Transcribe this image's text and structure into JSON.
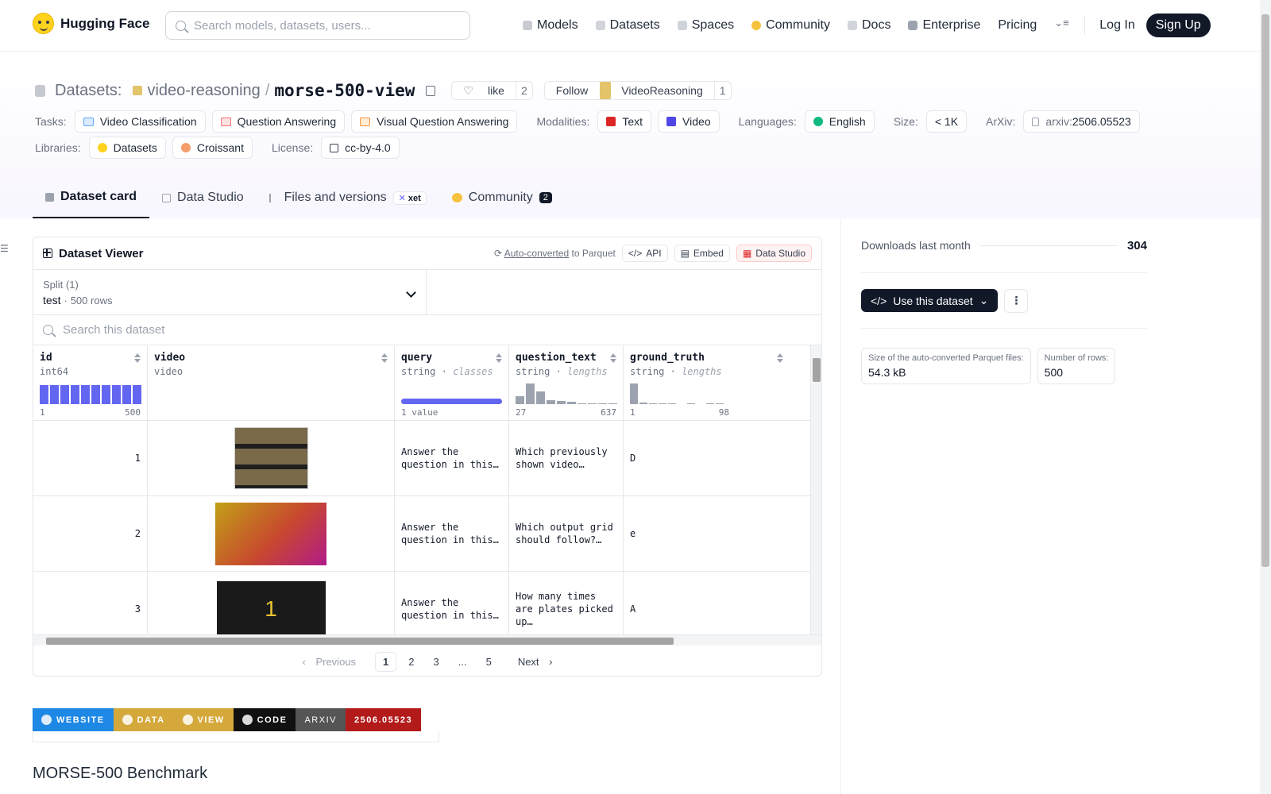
{
  "nav": {
    "brand": "Hugging Face",
    "search_placeholder": "Search models, datasets, users...",
    "links": [
      "Models",
      "Datasets",
      "Spaces",
      "Community",
      "Docs",
      "Enterprise",
      "Pricing"
    ],
    "login": "Log In",
    "signup": "Sign Up"
  },
  "header": {
    "crumb_label": "Datasets:",
    "org": "video-reasoning",
    "name": "morse-500-view",
    "like_label": "like",
    "like_count": "2",
    "follow_label": "Follow",
    "follow_org": "VideoReasoning",
    "follow_count": "1"
  },
  "tags": {
    "tasks_label": "Tasks:",
    "tasks": [
      "Video Classification",
      "Question Answering",
      "Visual Question Answering"
    ],
    "modalities_label": "Modalities:",
    "modalities": [
      "Text",
      "Video"
    ],
    "languages_label": "Languages:",
    "language": "English",
    "size_label": "Size:",
    "size": "< 1K",
    "arxiv_label": "ArXiv:",
    "arxiv_prefix": "arxiv:",
    "arxiv_id": "2506.05523",
    "libraries_label": "Libraries:",
    "libraries": [
      "Datasets",
      "Croissant"
    ],
    "license_label": "License:",
    "license": "cc-by-4.0"
  },
  "tabs": [
    "Dataset card",
    "Data Studio",
    "Files and versions",
    "Community"
  ],
  "tabs_extra": {
    "xet": "xet",
    "community_count": "2"
  },
  "viewer": {
    "title": "Dataset Viewer",
    "auto_converted": "Auto-converted",
    "to_parquet": "to Parquet",
    "api": "API",
    "embed": "Embed",
    "data_studio": "Data Studio",
    "split_label": "Split (1)",
    "split_value": "test",
    "split_sep": "·",
    "split_rows": "500 rows",
    "search_placeholder": "Search this dataset",
    "columns": [
      {
        "name": "id",
        "type": "int64",
        "hint": "",
        "min": "1",
        "max": "500"
      },
      {
        "name": "video",
        "type": "video",
        "hint": "",
        "min": "",
        "max": ""
      },
      {
        "name": "query",
        "type": "string",
        "hint": "classes",
        "min": "1 value",
        "max": ""
      },
      {
        "name": "question_text",
        "type": "string",
        "hint": "lengths",
        "min": "27",
        "max": "637"
      },
      {
        "name": "ground_truth",
        "type": "string",
        "hint": "lengths",
        "min": "1",
        "max": "98"
      }
    ],
    "type_sep": "·",
    "rows": [
      {
        "id": "1",
        "thumb_text": "",
        "query": "Answer the question in this…",
        "question": "Which previously shown video…",
        "truth": "D"
      },
      {
        "id": "2",
        "thumb_text": "",
        "query": "Answer the question in this…",
        "question": "Which output grid should follow?…",
        "truth": "e"
      },
      {
        "id": "3",
        "thumb_text": "1",
        "query": "Answer the question in this…",
        "question": "How many times are plates picked up…",
        "truth": "A"
      }
    ],
    "pager": {
      "prev": "Previous",
      "pages": [
        "1",
        "2",
        "3",
        "...",
        "5"
      ],
      "next": "Next"
    }
  },
  "shields": [
    {
      "text": "WEBSITE",
      "color": "#1e88e5"
    },
    {
      "text": "DATA",
      "color": "#d4a83a"
    },
    {
      "text": "VIEW",
      "color": "#d4a83a"
    },
    {
      "text": "CODE",
      "color": "#111111"
    },
    {
      "text": "ARXIV",
      "color": "#555555"
    },
    {
      "text": "2506.05523",
      "color": "#b31b1b"
    }
  ],
  "bench_title": "MORSE-500 Benchmark",
  "sidebar": {
    "downloads_label": "Downloads last month",
    "downloads": "304",
    "use_button": "Use this dataset",
    "parquet_label": "Size of the auto-converted Parquet files:",
    "parquet_size": "54.3 kB",
    "rows_label": "Number of rows:",
    "rows": "500"
  },
  "colors": {
    "accent": "#6366f1",
    "dark": "#111827"
  }
}
